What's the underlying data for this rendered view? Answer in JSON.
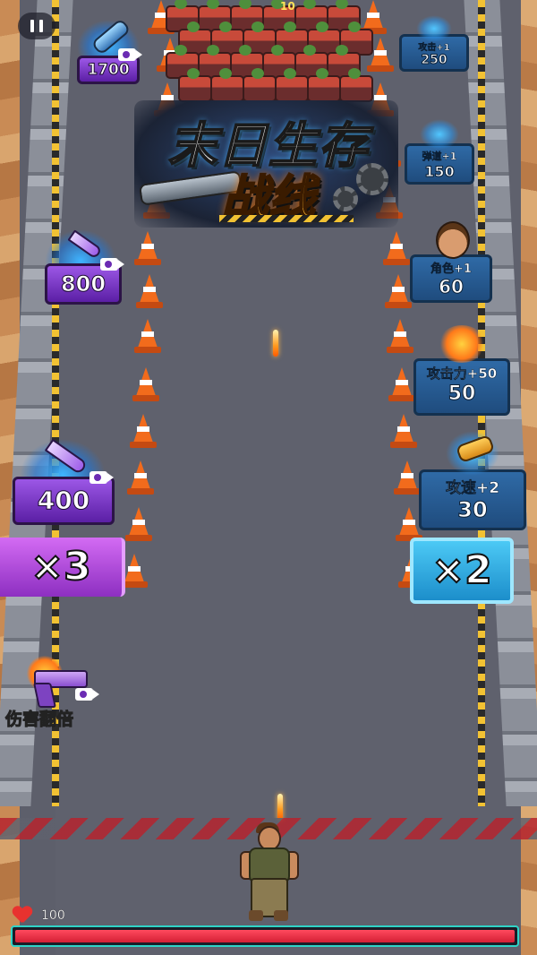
{
  "logo": {
    "line1": "末日生存",
    "line2": "战线"
  },
  "wave_counter": "10",
  "pause_icon": "pause-icon",
  "left_rewards": [
    {
      "id": "rocket",
      "value": "1700",
      "icon": "rocket-icon"
    },
    {
      "id": "dagger",
      "value": "800",
      "icon": "dagger-icon"
    },
    {
      "id": "blade",
      "value": "400",
      "icon": "blade-icon"
    }
  ],
  "right_upgrades": [
    {
      "id": "attack",
      "label": "攻击+1",
      "value": "250",
      "icon": "bullet-icon"
    },
    {
      "id": "trajectory",
      "label": "弹道+1",
      "value": "150",
      "icon": "bullets-icon"
    },
    {
      "id": "character",
      "label": "角色+1",
      "value": "60",
      "icon": "hero-portrait-icon"
    },
    {
      "id": "power",
      "label": "攻击力+50",
      "value": "50",
      "icon": "power-bullet-icon"
    },
    {
      "id": "speed",
      "label": "攻速+2",
      "value": "30",
      "icon": "speed-bullet-icon"
    }
  ],
  "gates": {
    "left": "×3",
    "right": "×2"
  },
  "powerup": {
    "label": "伤害翻倍",
    "icon": "pistol-icon"
  },
  "hp": {
    "text": "100",
    "fraction": 1.0
  },
  "colors": {
    "purple_drum": "#8a3fd6",
    "blue_box": "#2a5f96",
    "hp_red": "#e8322f",
    "hp_border": "#2fd3c7"
  }
}
